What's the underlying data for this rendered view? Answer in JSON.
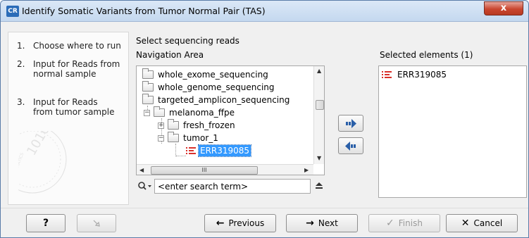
{
  "window": {
    "app_badge": "CR",
    "title": "Identify Somatic Variants from Tumor Normal Pair (TAS)",
    "close_glyph": "x"
  },
  "steps": [
    {
      "number": "1.",
      "label": "Choose where to run"
    },
    {
      "number": "2.",
      "label": "Input for Reads from normal sample"
    },
    {
      "number": "3.",
      "label": "Input for Reads from tumor sample"
    }
  ],
  "main": {
    "heading": "Select sequencing reads",
    "navigation_label": "Navigation Area",
    "selected_label": "Selected elements (1)"
  },
  "tree": {
    "items": [
      {
        "label": "whole_exome_sequencing",
        "icon": "folder-icon"
      },
      {
        "label": "whole_genome_sequencing",
        "icon": "folder-icon"
      },
      {
        "label": "targeted_amplicon_sequencing",
        "icon": "folder-open-icon"
      },
      {
        "label": "melanoma_ffpe",
        "icon": "folder-open-icon",
        "expander": "−"
      },
      {
        "label": "fresh_frozen",
        "icon": "folder-icon",
        "expander": "+"
      },
      {
        "label": "tumor_1",
        "icon": "folder-open-icon",
        "expander": "−"
      },
      {
        "label": "ERR319085",
        "icon": "sequence-list-icon",
        "selected": true
      }
    ],
    "hscroll_grip": "III"
  },
  "search": {
    "placeholder": "<enter search term>",
    "value": "<enter search term>"
  },
  "selected_elements": [
    {
      "label": "ERR319085",
      "icon": "sequence-list-icon"
    }
  ],
  "buttons": {
    "help": "?",
    "previous": "Previous",
    "next": "Next",
    "finish": "Finish",
    "cancel": "Cancel"
  },
  "colors": {
    "selection": "#3399ff",
    "sequence_icon": "#d9302a",
    "move_arrow": "#2a5fa8",
    "title_bar": "#c4d8ef",
    "close_button": "#c9462f"
  }
}
